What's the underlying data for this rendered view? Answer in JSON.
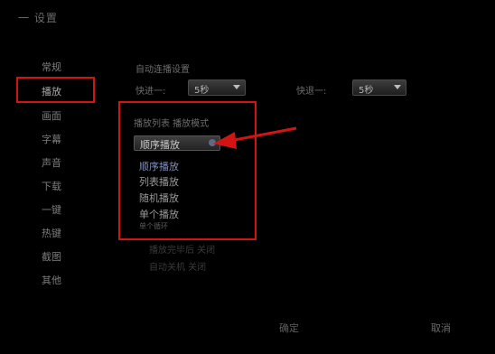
{
  "window": {
    "title": "一 设置"
  },
  "sidebar": {
    "items": [
      {
        "label": "常规",
        "active": false
      },
      {
        "label": "播放",
        "active": true
      },
      {
        "label": "画面",
        "active": false
      },
      {
        "label": "字幕",
        "active": false
      },
      {
        "label": "声音",
        "active": false
      },
      {
        "label": "下载",
        "active": false
      },
      {
        "label": "一键",
        "active": false
      },
      {
        "label": "热键",
        "active": false
      },
      {
        "label": "截图",
        "active": false
      },
      {
        "label": "其他",
        "active": false
      }
    ]
  },
  "content": {
    "section_label": "自动连播设置",
    "row1": {
      "left_label": "快进一:",
      "left_value": "5秒",
      "right_label": "快退一:",
      "right_value": "5秒"
    },
    "play_mode": {
      "label": "播放列表 播放模式",
      "selected": "顺序播放",
      "options": [
        "顺序播放",
        "列表播放",
        "随机播放",
        "单个播放",
        "单个循环"
      ]
    },
    "faint_lines": [
      "播放完毕后 关闭",
      "自动关机 关闭"
    ],
    "bottom_left": "确定",
    "ok": "取消"
  },
  "colors": {
    "highlight": "#d21414",
    "accent": "#7f8fc0"
  }
}
